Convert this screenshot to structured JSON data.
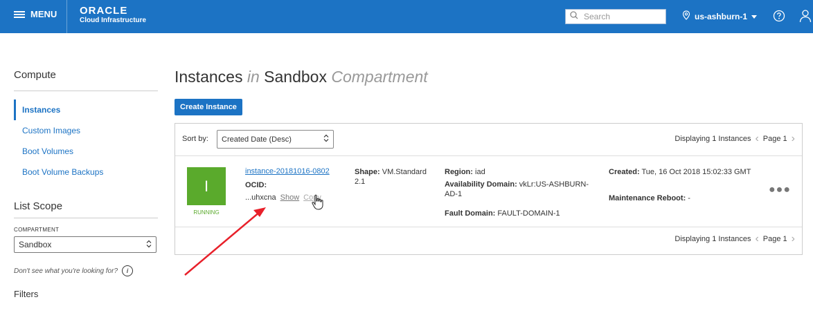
{
  "topbar": {
    "menu_label": "MENU",
    "logo_line1": "ORACLE",
    "logo_line2": "Cloud Infrastructure",
    "search_placeholder": "Search",
    "region": "us-ashburn-1"
  },
  "sidebar": {
    "heading": "Compute",
    "items": [
      {
        "label": "Instances",
        "active": true
      },
      {
        "label": "Custom Images"
      },
      {
        "label": "Boot Volumes"
      },
      {
        "label": "Boot Volume Backups"
      }
    ],
    "scope_heading": "List Scope",
    "compartment_label": "COMPARTMENT",
    "compartment_value": "Sandbox",
    "dont_see": "Don't see what you're looking for?",
    "filters_heading": "Filters"
  },
  "main": {
    "title_a": "Instances",
    "title_in": "in",
    "title_b": "Sandbox",
    "title_c": "Compartment",
    "create_label": "Create Instance",
    "sort_label": "Sort by:",
    "sort_value": "Created Date (Desc)",
    "displaying": "Displaying 1 Instances",
    "page": "Page 1"
  },
  "instance": {
    "initial": "I",
    "status": "RUNNING",
    "name": "instance-20181016-0802",
    "ocid_label": "OCID:",
    "ocid_value": "...uhxcna",
    "show": "Show",
    "copy": "Copy",
    "shape_label": "Shape:",
    "shape_value": "VM.Standard 2.1",
    "region_label": "Region:",
    "region_value": "iad",
    "ad_label": "Availability Domain:",
    "ad_value": "vkLr:US-ASHBURN-AD-1",
    "fd_label": "Fault Domain:",
    "fd_value": "FAULT-DOMAIN-1",
    "created_label": "Created:",
    "created_value": "Tue, 16 Oct 2018 15:02:33 GMT",
    "reboot_label": "Maintenance Reboot:",
    "reboot_value": "-"
  },
  "colors": {
    "brand": "#1c73c4",
    "running": "#5aaa2c",
    "arrow": "#e8202a"
  }
}
